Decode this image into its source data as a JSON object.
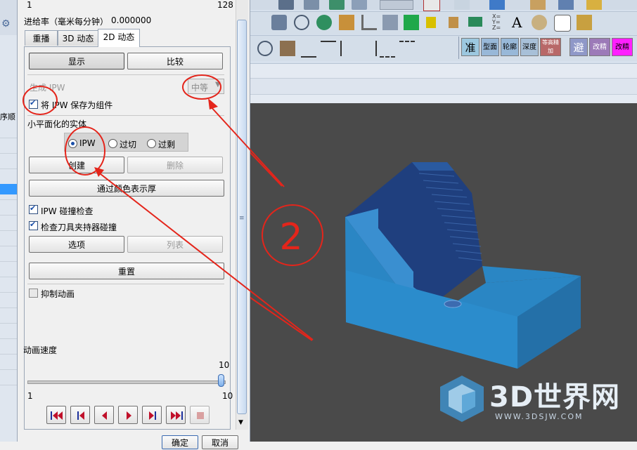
{
  "dialog": {
    "top_left_value": "1",
    "top_right_value": "128",
    "feed_rate_label": "进给率（毫米每分钟）",
    "feed_rate_value": "0.000000",
    "tabs": [
      {
        "label": "重播"
      },
      {
        "label": "3D 动态"
      },
      {
        "label": "2D 动态"
      }
    ],
    "buttons": {
      "display": "显示",
      "compare": "比较",
      "create": "创建",
      "delete": "删除",
      "color_thickness": "通过颜色表示厚",
      "options": "选项",
      "list": "列表",
      "reset": "重置"
    },
    "generate_ipw_label": "生成 IPW",
    "generate_ipw_quality": "中等",
    "save_ipw_label": "将 IPW 保存为组件",
    "facet_solid_label": "小平面化的实体",
    "radios": {
      "ipw": "IPW",
      "overcut": "过切",
      "excess": "过剩"
    },
    "checkboxes": {
      "collision_check": "IPW 碰撞检查",
      "holder_collision": "检查刀具夹持器碰撞",
      "suppress_animation": "抑制动画"
    },
    "animation_speed_label": "动画速度",
    "speed_value": "10",
    "speed_min": "1",
    "speed_max": "10",
    "speed_fraction": 1.0,
    "bottom_buttons": {
      "ok": "确定",
      "cancel": "取消"
    }
  },
  "toolbar": {
    "labels": [
      "准",
      "型面",
      "轮廓",
      "深度",
      "等高精加",
      "避",
      "改精",
      "改精"
    ]
  },
  "watermark": {
    "brand": "3D世界网",
    "url": "WWW.3DSJW.COM"
  },
  "annotation": {
    "number": "2"
  },
  "colors": {
    "viewport_bg": "#4a4a4a",
    "model_side": "#2a86c4",
    "model_top": "#1f3f7e",
    "annotation_red": "#e4251b",
    "selection_blue": "#3399ff"
  }
}
